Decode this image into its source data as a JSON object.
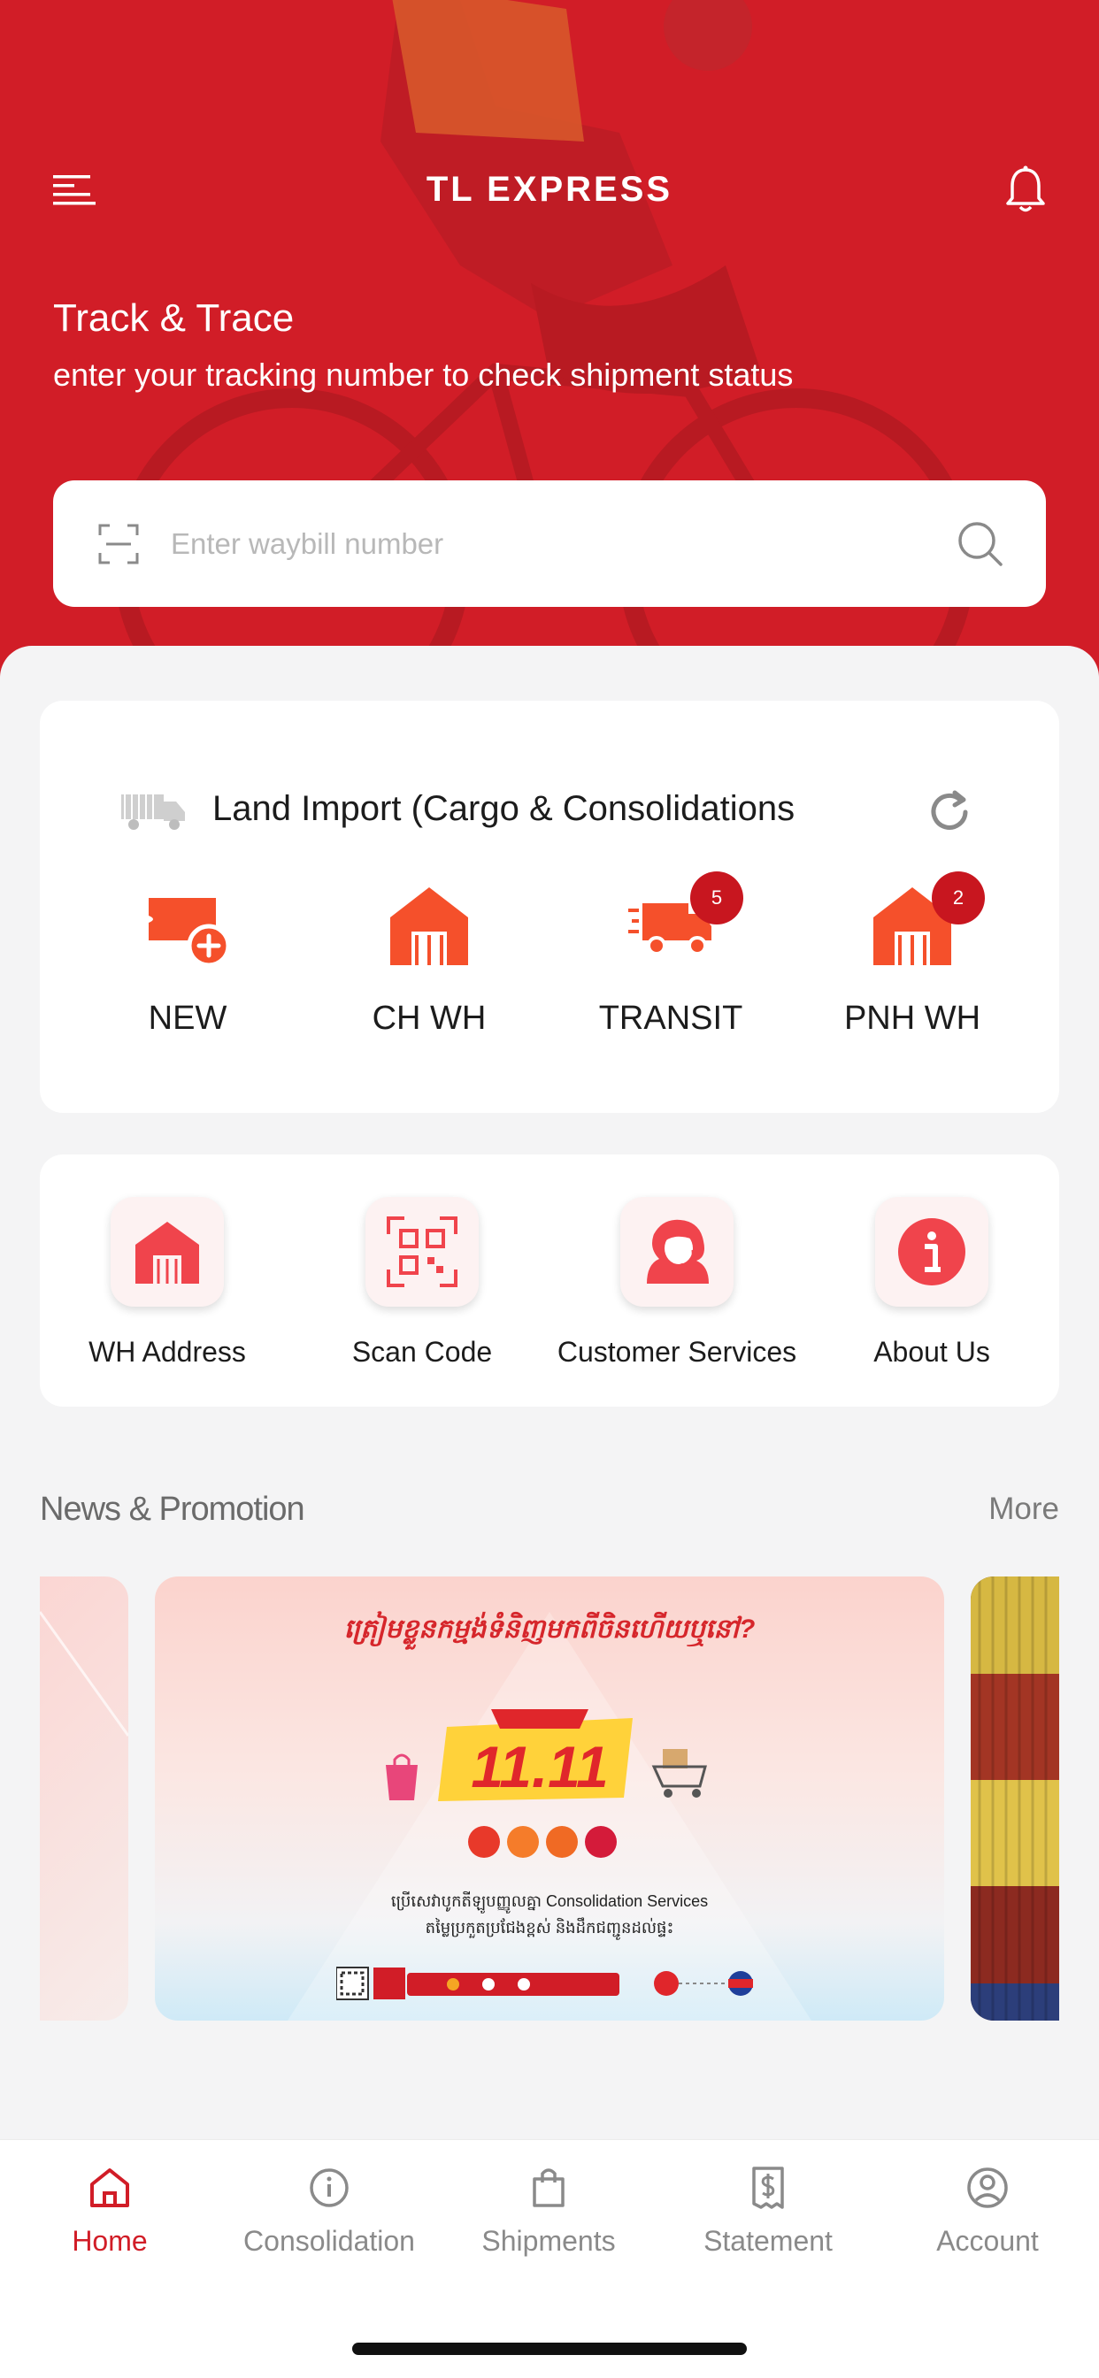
{
  "header": {
    "title": "TL EXPRESS",
    "menu_icon": "menu-icon",
    "bell_icon": "bell-icon"
  },
  "hero": {
    "title": "Track & Trace",
    "subtitle": "enter your tracking number to check shipment status",
    "search_placeholder": "Enter waybill number"
  },
  "import_section": {
    "title": "Land Import (Cargo & Consolidations",
    "items": [
      {
        "label": "NEW",
        "icon": "new-shipment-icon",
        "badge": ""
      },
      {
        "label": "CH WH",
        "icon": "warehouse-icon",
        "badge": ""
      },
      {
        "label": "TRANSIT",
        "icon": "truck-icon",
        "badge": "5"
      },
      {
        "label": "PNH WH",
        "icon": "warehouse-icon",
        "badge": "2"
      }
    ]
  },
  "quick_actions": [
    {
      "label": "WH Address",
      "icon": "warehouse-icon"
    },
    {
      "label": "Scan Code",
      "icon": "qr-code-icon"
    },
    {
      "label": "Customer Services",
      "icon": "support-agent-icon"
    },
    {
      "label": "About Us",
      "icon": "info-icon"
    }
  ],
  "news": {
    "title": "News & Promotion",
    "more": "More",
    "banner": {
      "headline": "ត្រៀមខ្លួនកម្មង់ទំនិញមកពីចិនហើយឬនៅ?",
      "big_text": "11.11",
      "line1": "ប្រើសេវាបូកតីឡូបញ្ញូលគ្នា Consolidation Services",
      "line2": "តម្លៃប្រកួតប្រជែងខ្ពស់ និងដឹកជញ្ជូនដល់ផ្ទះ"
    }
  },
  "tabbar": [
    {
      "label": "Home",
      "icon": "home-icon",
      "active": true
    },
    {
      "label": "Consolidation",
      "icon": "info-icon",
      "active": false
    },
    {
      "label": "Shipments",
      "icon": "bag-icon",
      "active": false
    },
    {
      "label": "Statement",
      "icon": "receipt-icon",
      "active": false
    },
    {
      "label": "Account",
      "icon": "account-icon",
      "active": false
    }
  ],
  "colors": {
    "brand_red": "#d11d27",
    "accent_orange": "#f5502b",
    "badge_red": "#c8161f"
  }
}
